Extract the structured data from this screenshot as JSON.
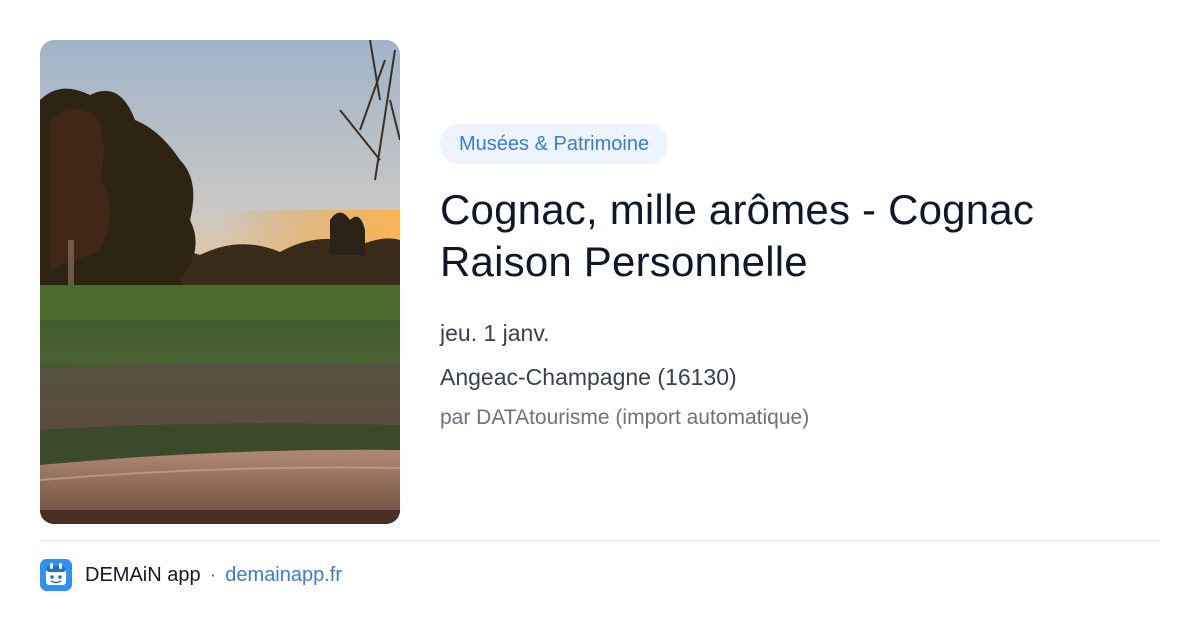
{
  "event": {
    "category": "Musées & Patrimoine",
    "title": "Cognac, mille arômes - Cognac Raison Personnelle",
    "date": "jeu. 1 janv.",
    "location": "Angeac-Champagne (16130)",
    "source": "par DATAtourisme (import automatique)",
    "image_icon": "landscape-sunset-photo"
  },
  "footer": {
    "app_name": "DEMAiN app",
    "separator": "·",
    "site": "demainapp.fr",
    "logo_icon": "demain-app-logo-icon"
  },
  "colors": {
    "accent": "#3a7bd5",
    "tag_background": "#eef4fd",
    "title": "#0f172a",
    "logo_background": "#2f8ff2"
  }
}
